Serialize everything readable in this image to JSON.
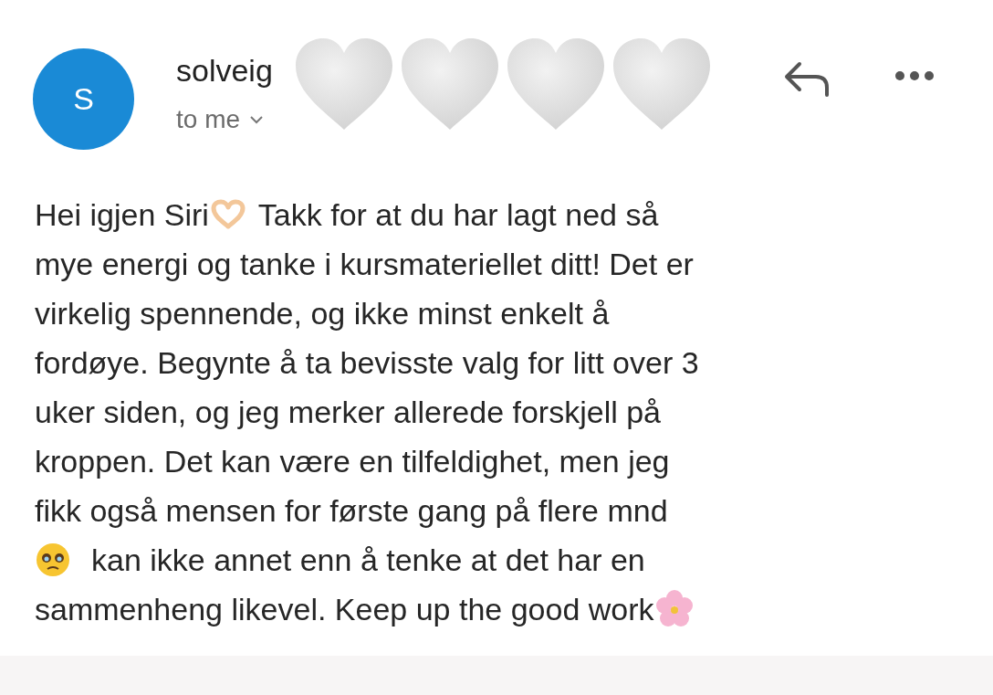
{
  "header": {
    "avatar_letter": "S",
    "sender": "solveig",
    "recipient": "to me",
    "stickers": [
      {
        "kind": "heart"
      },
      {
        "kind": "heart"
      },
      {
        "kind": "heart"
      },
      {
        "kind": "heart"
      }
    ]
  },
  "body_lines": [
    [
      {
        "kind": "text",
        "text": "Hei igjen Siri"
      },
      {
        "kind": "heart_hands"
      },
      {
        "kind": "text",
        "text": "Takk for at du har lagt ned så"
      }
    ],
    [
      {
        "kind": "text",
        "text": "mye energi og tanke i kursmateriellet ditt! Det er"
      }
    ],
    [
      {
        "kind": "text",
        "text": "virkelig spennende, og ikke minst enkelt å"
      }
    ],
    [
      {
        "kind": "text",
        "text": "fordøye. Begynte å ta bevisste valg for litt over 3"
      }
    ],
    [
      {
        "kind": "text",
        "text": "uker siden, og jeg merker allerede forskjell på"
      }
    ],
    [
      {
        "kind": "text",
        "text": "kroppen. Det kan være en tilfeldighet, men jeg"
      }
    ],
    [
      {
        "kind": "text",
        "text": "fikk også mensen for første gang på flere mnd"
      }
    ],
    [
      {
        "kind": "pleading_face"
      },
      {
        "kind": "text",
        "text": "kan ikke annet enn å tenke at det har en"
      }
    ],
    [
      {
        "kind": "text",
        "text": "sammenheng likevel. Keep up the good work"
      },
      {
        "kind": "blossom"
      }
    ]
  ]
}
